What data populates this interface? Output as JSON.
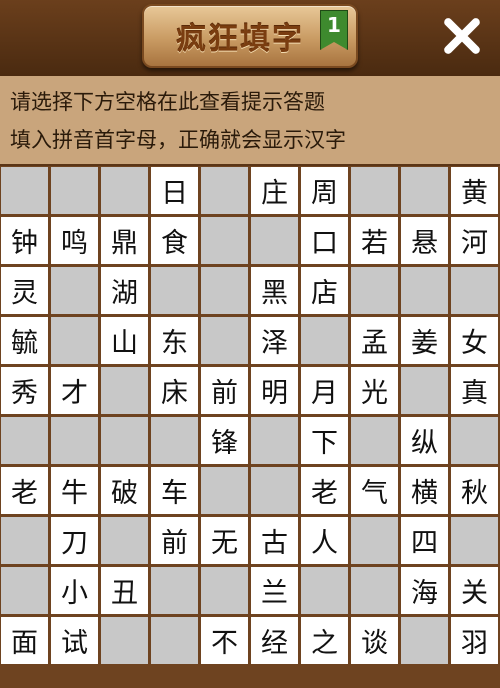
{
  "header": {
    "title": "疯狂填字",
    "level": "1",
    "close_icon": "close-icon"
  },
  "hint": {
    "line1": "请选择下方空格在此查看提示答题",
    "line2": "填入拼音首字母，正确就会显示汉字"
  },
  "grid": {
    "rows": [
      [
        "",
        "",
        "",
        "日",
        "",
        "庄",
        "周",
        "",
        "",
        "黄"
      ],
      [
        "钟",
        "鸣",
        "鼎",
        "食",
        "",
        "",
        "口",
        "若",
        "悬",
        "河"
      ],
      [
        "灵",
        "",
        "湖",
        "",
        "",
        "黑",
        "店",
        "",
        "",
        ""
      ],
      [
        "毓",
        "",
        "山",
        "东",
        "",
        "泽",
        "",
        "孟",
        "姜",
        "女"
      ],
      [
        "秀",
        "才",
        "",
        "床",
        "前",
        "明",
        "月",
        "光",
        "",
        "真"
      ],
      [
        "",
        "",
        "",
        "",
        "锋",
        "",
        "下",
        "",
        "纵",
        ""
      ],
      [
        "老",
        "牛",
        "破",
        "车",
        "",
        "",
        "老",
        "气",
        "横",
        "秋"
      ],
      [
        "",
        "刀",
        "",
        "前",
        "无",
        "古",
        "人",
        "",
        "四",
        ""
      ],
      [
        "",
        "小",
        "丑",
        "",
        "",
        "兰",
        "",
        "",
        "海",
        "关"
      ],
      [
        "面",
        "试",
        "",
        "",
        "不",
        "经",
        "之",
        "谈",
        "",
        "羽"
      ]
    ],
    "cell_types": [
      [
        "g",
        "g",
        "g",
        "w",
        "g",
        "w",
        "w",
        "g",
        "g",
        "w"
      ],
      [
        "w",
        "w",
        "w",
        "w",
        "g",
        "g",
        "w",
        "w",
        "w",
        "w"
      ],
      [
        "w",
        "g",
        "w",
        "g",
        "g",
        "w",
        "w",
        "g",
        "g",
        "g"
      ],
      [
        "w",
        "g",
        "w",
        "w",
        "g",
        "w",
        "g",
        "w",
        "w",
        "w"
      ],
      [
        "w",
        "w",
        "g",
        "w",
        "w",
        "w",
        "w",
        "w",
        "g",
        "w"
      ],
      [
        "g",
        "g",
        "g",
        "g",
        "w",
        "g",
        "w",
        "g",
        "w",
        "g"
      ],
      [
        "w",
        "w",
        "w",
        "w",
        "g",
        "g",
        "w",
        "w",
        "w",
        "w"
      ],
      [
        "g",
        "w",
        "g",
        "w",
        "w",
        "w",
        "w",
        "g",
        "w",
        "g"
      ],
      [
        "g",
        "w",
        "w",
        "g",
        "g",
        "w",
        "g",
        "g",
        "w",
        "w"
      ],
      [
        "w",
        "w",
        "g",
        "g",
        "w",
        "w",
        "w",
        "w",
        "g",
        "w"
      ]
    ]
  },
  "colors": {
    "white_cell": "#ffffff",
    "gray_cell": "#c8c8c8",
    "grid_line": "#6e4320",
    "hint_bg": "#c9a57c",
    "header_bg": "#5a3516"
  }
}
